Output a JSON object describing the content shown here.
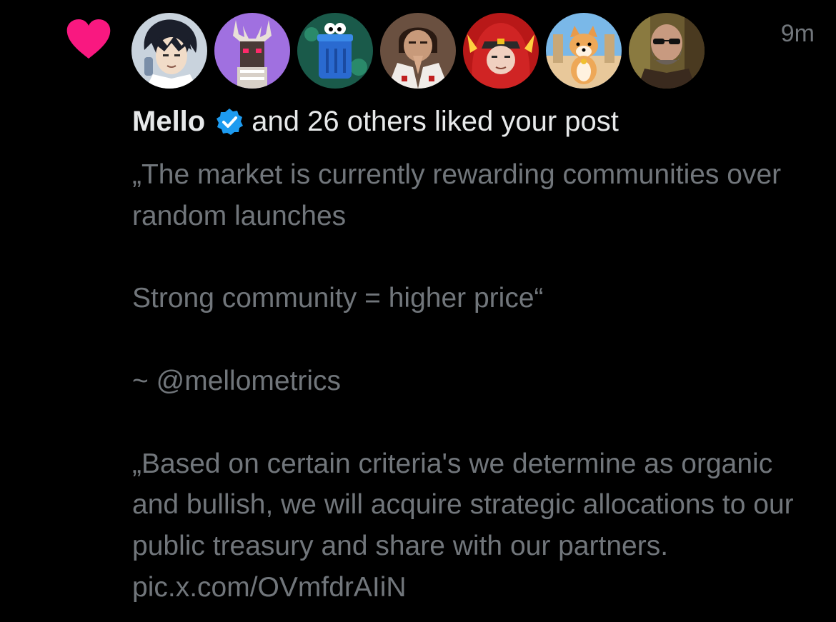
{
  "notification": {
    "timestamp": "9m",
    "liker_name": "Mello",
    "liked_text": "and 26 others liked your post",
    "avatars": [
      {
        "icon": "avatar-anime-character"
      },
      {
        "icon": "avatar-pixel-deer"
      },
      {
        "icon": "avatar-blue-creature"
      },
      {
        "icon": "avatar-anime-praying"
      },
      {
        "icon": "avatar-red-hoodie"
      },
      {
        "icon": "avatar-shiba-dog"
      },
      {
        "icon": "avatar-bearded-man"
      }
    ],
    "post": {
      "paragraphs": [
        "„The market is currently rewarding communities over random launches",
        "Strong community = higher price“",
        "~ @mellometrics",
        "„Based on certain criteria's we determine as organic and bullish, we will acquire strategic allocations to our public treasury and share with our partners. pic.x.com/OVmfdrAIiN"
      ]
    }
  },
  "colors": {
    "background": "#000000",
    "heart": "#f91880",
    "primary_text": "#e7e9ea",
    "secondary_text": "#71767b",
    "verified": "#1d9bf0"
  }
}
